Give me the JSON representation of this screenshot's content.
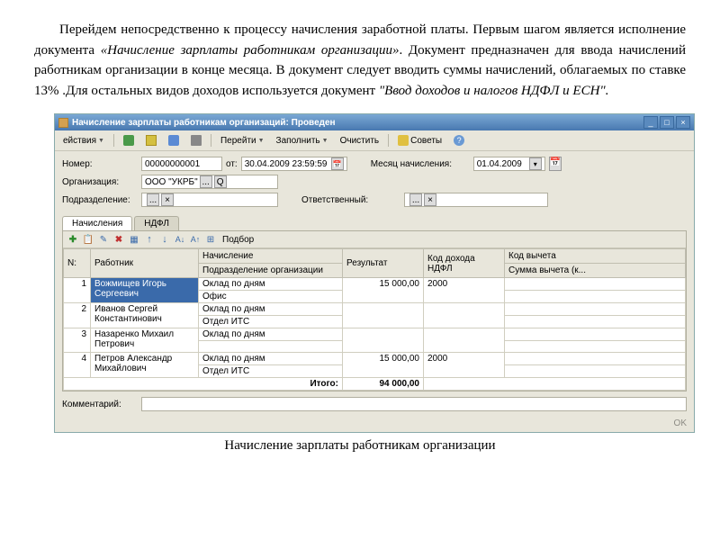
{
  "intro": {
    "p1a": "Перейдем непосредственно к процессу начисления заработной платы. Первым шагом является исполнение документа ",
    "p1b": "«Начисление зарплаты работникам организации»",
    "p1c": ". Документ предназначен для ввода начислений работникам  организации в конце месяца. В документ следует вводить суммы начислений, облагаемых по ставке 13% .Для остальных видов доходов используется документ ",
    "p1d": "\"Ввод доходов и налогов НДФЛ и ЕСН\".",
    "caption": "Начисление зарплаты работникам организации"
  },
  "window": {
    "title": "Начисление зарплаты работникам организаций: Проведен"
  },
  "toolbar": {
    "actions": "ействия",
    "goto": "Перейти",
    "fill": "Заполнить",
    "clear": "Очистить",
    "tips": "Советы"
  },
  "form": {
    "number_label": "Номер:",
    "number": "00000000001",
    "from_label": "от:",
    "date": "30.04.2009 23:59:59",
    "month_label": "Месяц начисления:",
    "month": "01.04.2009",
    "org_label": "Организация:",
    "org": "ООО \"УКРБ\"",
    "dept_label": "Подразделение:",
    "resp_label": "Ответственный:",
    "comment_label": "Комментарий:"
  },
  "tabs": {
    "t1": "Начисления",
    "t2": "НДФЛ"
  },
  "grid": {
    "podbor": "Подбор",
    "h_n": "N:",
    "h_emp": "Работник",
    "h_acc": "Начисление",
    "h_sub": "Подразделение организации",
    "h_res": "Результат",
    "h_code": "Код дохода НДФЛ",
    "h_vych": "Код вычета",
    "h_sum": "Сумма вычета (к...",
    "rows": [
      {
        "n": "1",
        "emp": "Вожмищев Игорь Сергеевич",
        "acc": "Оклад по дням",
        "sub": "Офис",
        "res": "15 000,00",
        "code": "2000"
      },
      {
        "n": "2",
        "emp": "Иванов Сергей Константинович",
        "acc": "Оклад по дням",
        "sub": "Отдел ИТС",
        "res": "",
        "code": ""
      },
      {
        "n": "3",
        "emp": "Назаренко Михаил Петрович",
        "acc": "Оклад по дням",
        "sub": "",
        "res": "",
        "code": ""
      },
      {
        "n": "4",
        "emp": "Петров Александр Михайлович",
        "acc": "Оклад по дням",
        "sub": "Отдел ИТС",
        "res": "15 000,00",
        "code": "2000"
      }
    ],
    "total_label": "Итого:",
    "total": "94 000,00"
  }
}
